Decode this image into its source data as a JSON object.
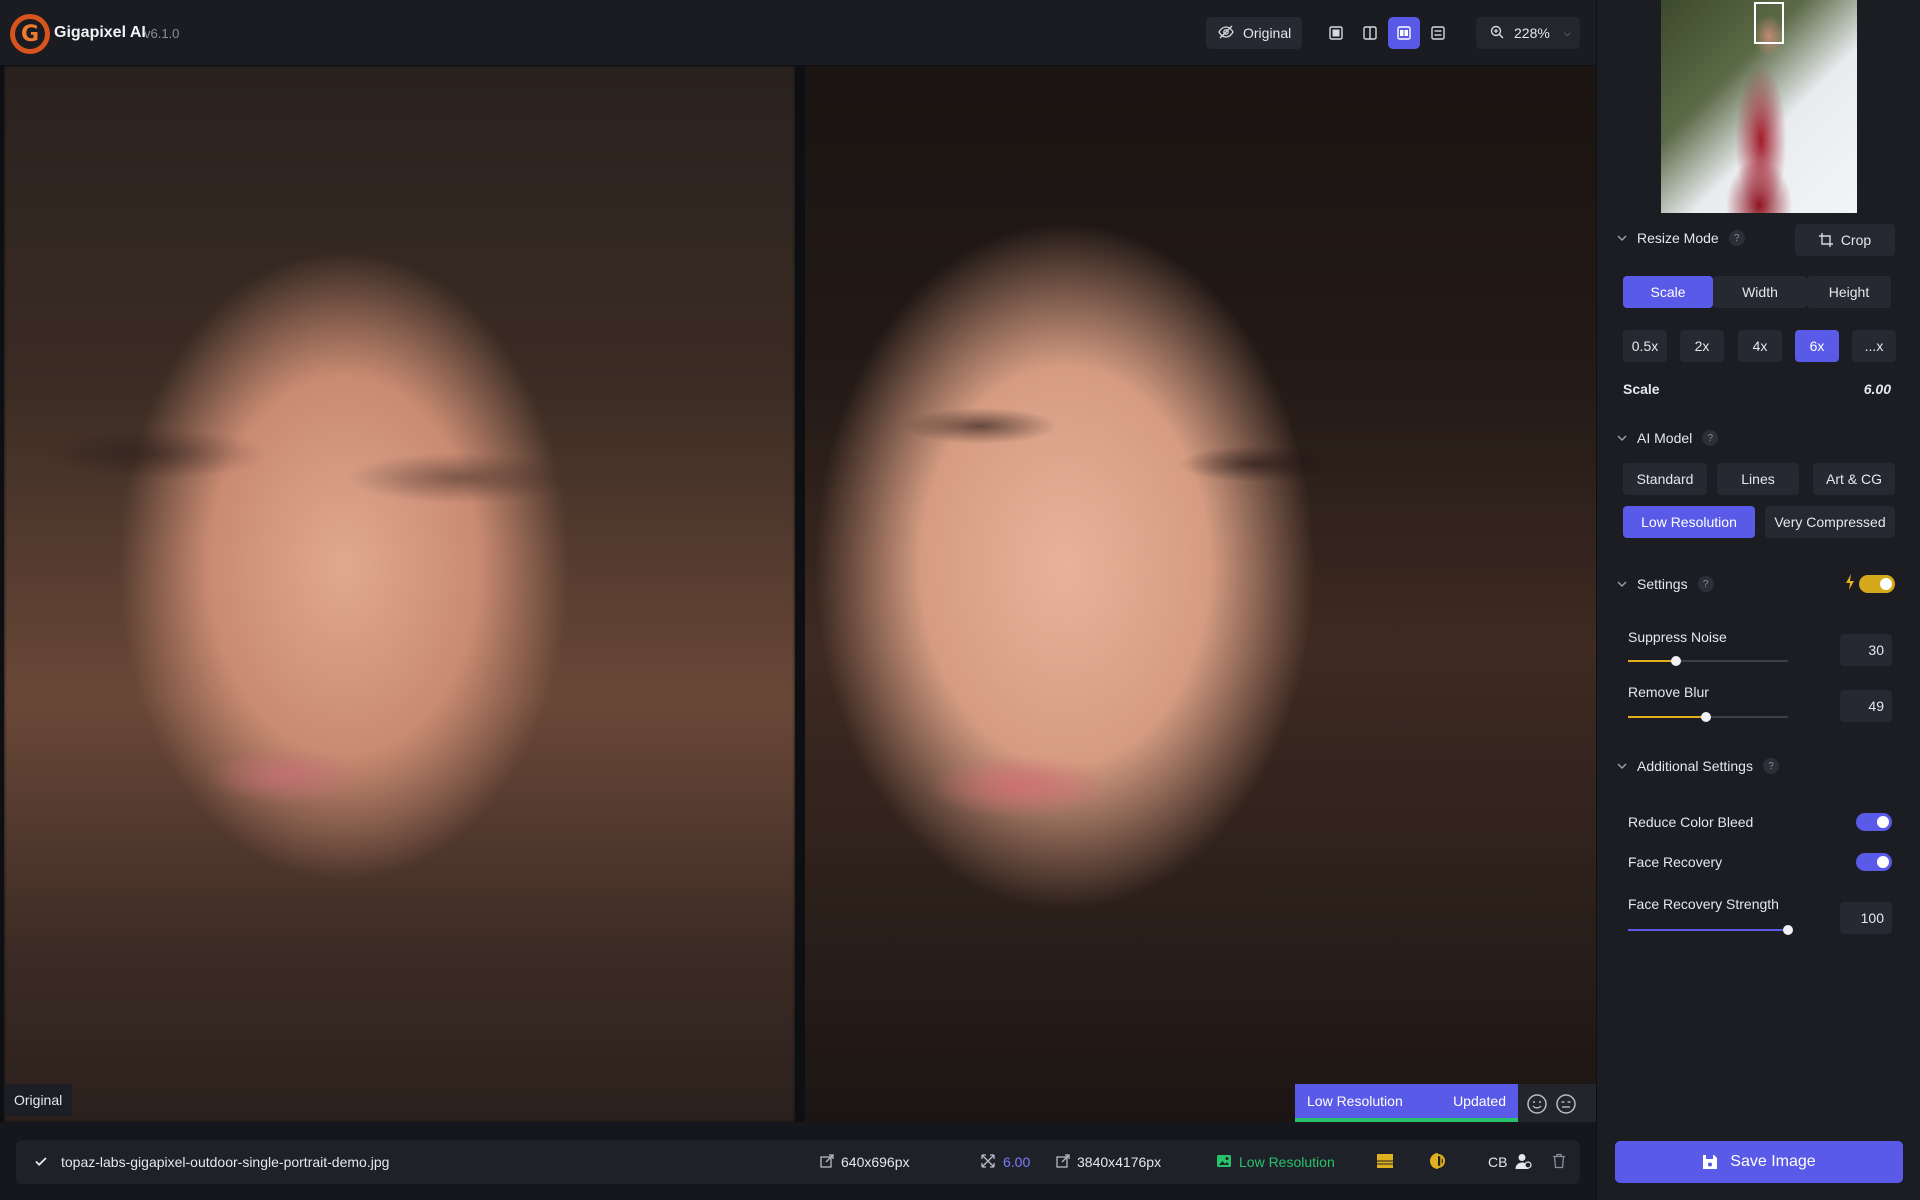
{
  "app": {
    "name": "Gigapixel AI",
    "version": "v6.1.0"
  },
  "toolbar": {
    "original_label": "Original",
    "view_modes": [
      "single-view-icon",
      "split-view-icon",
      "side-by-side-icon",
      "quad-view-icon"
    ],
    "active_view_mode": 2,
    "zoom_level": "228%"
  },
  "preview": {
    "left_label": "Original",
    "status_model": "Low Resolution",
    "status_state": "Updated"
  },
  "file_bar": {
    "filename": "topaz-labs-gigapixel-outdoor-single-portrait-demo.jpg",
    "input_size": "640x696px",
    "scale": "6.00",
    "output_size": "3840x4176px",
    "model": "Low Resolution",
    "cb_label": "CB"
  },
  "sidebar": {
    "resize_mode": {
      "title": "Resize Mode",
      "help": "?",
      "crop_label": "Crop",
      "tabs": [
        "Scale",
        "Width",
        "Height"
      ],
      "active_tab": 0,
      "presets": [
        "0.5x",
        "2x",
        "4x",
        "6x",
        "...x"
      ],
      "active_preset": 3,
      "scale_label": "Scale",
      "scale_value": "6.00"
    },
    "ai_model": {
      "title": "AI Model",
      "help": "?",
      "row1": [
        "Standard",
        "Lines",
        "Art & CG"
      ],
      "row2": [
        "Low Resolution",
        "Very Compressed"
      ],
      "active": "Low Resolution"
    },
    "settings": {
      "title": "Settings",
      "help": "?",
      "auto_toggle_on": true,
      "suppress_noise_label": "Suppress Noise",
      "suppress_noise_value": "30",
      "remove_blur_label": "Remove Blur",
      "remove_blur_value": "49"
    },
    "additional": {
      "title": "Additional Settings",
      "help": "?",
      "reduce_color_bleed_label": "Reduce Color Bleed",
      "reduce_color_bleed_on": true,
      "face_recovery_label": "Face Recovery",
      "face_recovery_on": true,
      "face_recovery_strength_label": "Face Recovery Strength",
      "face_recovery_strength_value": "100"
    },
    "save_label": "Save Image"
  },
  "colors": {
    "accent": "#5a5ae8",
    "success": "#27c26a",
    "warning": "#d6a81c",
    "brand": "#d7541f"
  }
}
